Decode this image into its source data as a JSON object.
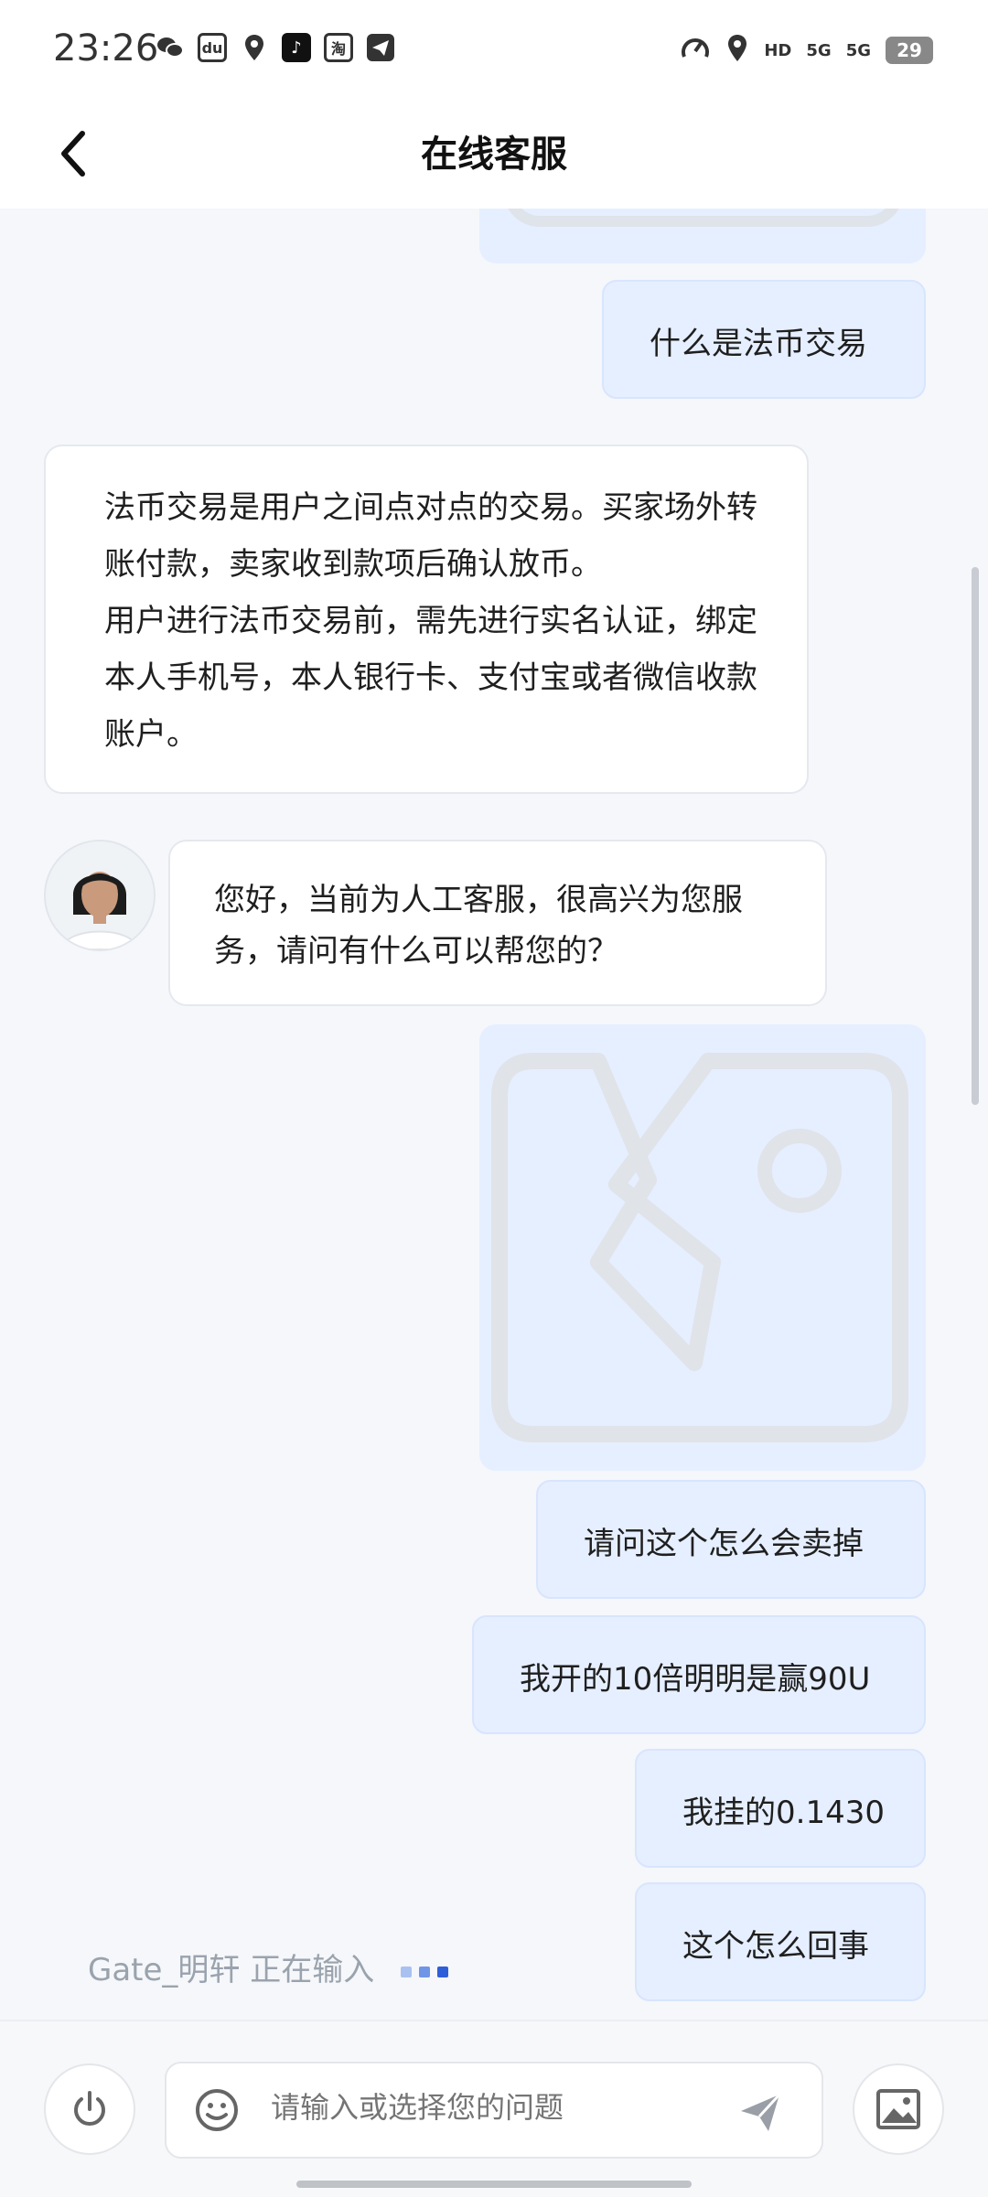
{
  "status_bar": {
    "time": "23:26",
    "left_icons": [
      "wechat-icon",
      "du-app-icon",
      "du-map-icon",
      "douyin-icon",
      "taobao-icon",
      "send-icon"
    ],
    "taobao_glyph": "淘",
    "du_glyph": "du",
    "hd": "HD",
    "sig1": "5G",
    "sig2": "5G",
    "battery": "29"
  },
  "header": {
    "title": "在线客服"
  },
  "messages": {
    "m1": "什么是法币交易",
    "m2_line1": "法币交易是用户之间点对点的交易。买家场外转账付款，卖家收到款项后确认放币。",
    "m2_line2": "用户进行法币交易前，需先进行实名认证，绑定本人手机号，本人银行卡、支付宝或者微信收款账户。",
    "m3": "您好，当前为人工客服，很高兴为您服务，请问有什么可以帮您的？",
    "m4": "请问这个怎么会卖掉",
    "m5": "我开的10倍明明是赢90U",
    "m6": "我挂的0.1430",
    "m7": "这个怎么回事"
  },
  "typing": {
    "text": "Gate_明轩 正在输入"
  },
  "composer": {
    "placeholder": "请输入或选择您的问题"
  },
  "colors": {
    "user_bubble": "#e6efff",
    "accent_dots": [
      "#a9c1f0",
      "#6f95e6",
      "#2f5fd8"
    ]
  }
}
